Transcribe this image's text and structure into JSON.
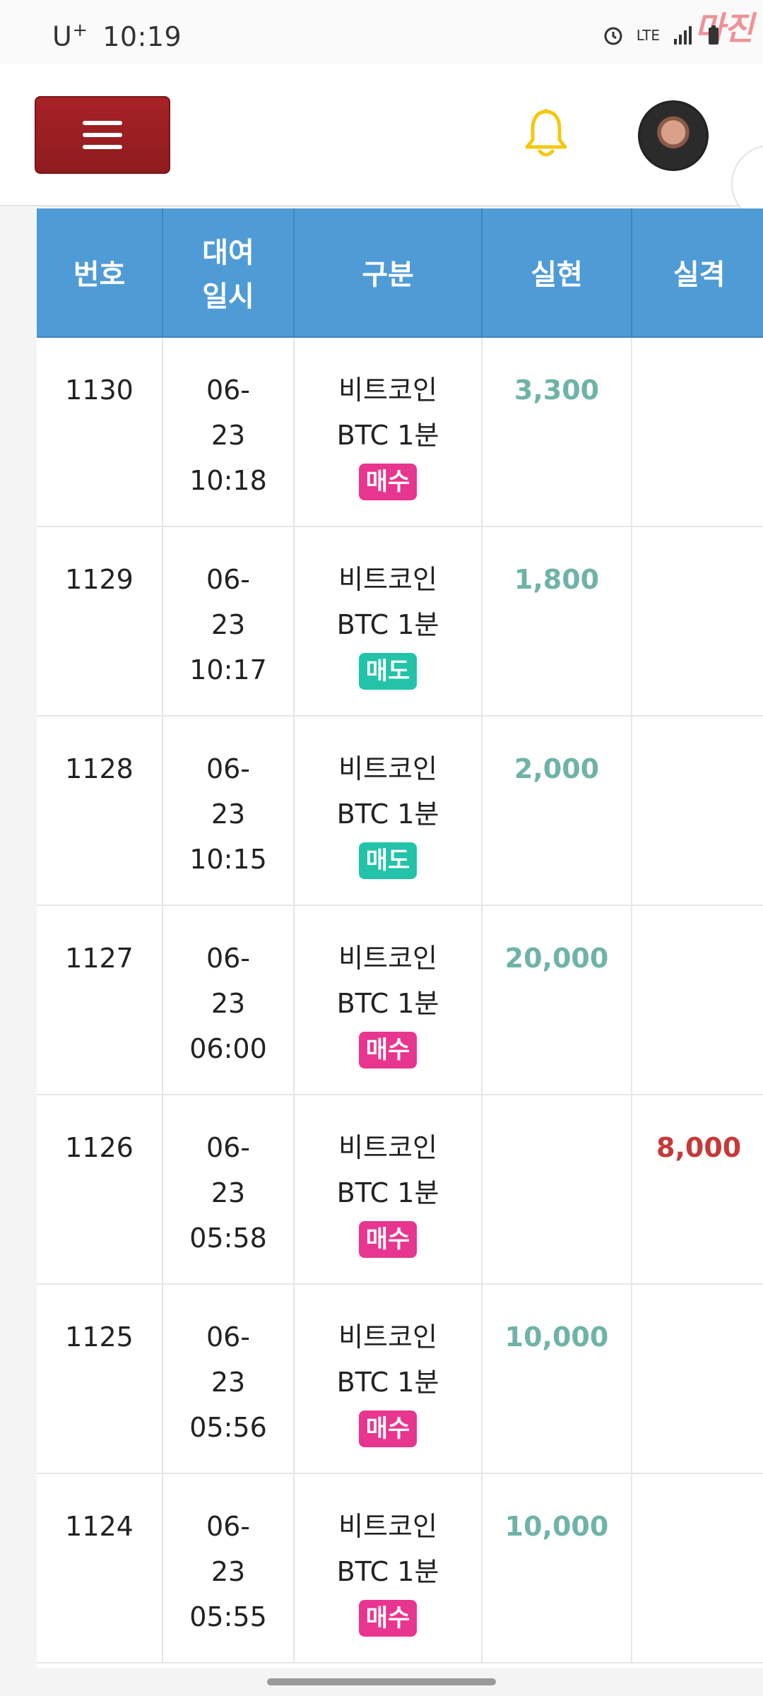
{
  "status_bar": {
    "carrier": "U",
    "carrier_sup": "+",
    "time": "10:19",
    "network": "LTE",
    "watermark": "마진"
  },
  "header": {
    "menu_icon": "hamburger-icon",
    "notification_icon": "bell-icon",
    "avatar": "user-avatar"
  },
  "table": {
    "headers": {
      "number": "번호",
      "date_line1": "대여",
      "date_line2": "일시",
      "category": "구분",
      "profit": "실현",
      "loss": "실격"
    },
    "rows": [
      {
        "number": "1130",
        "date1": "06-",
        "date2": "23",
        "time": "10:18",
        "asset": "비트코인",
        "product": "BTC 1분",
        "side": "매수",
        "side_type": "buy",
        "profit": "3,300",
        "loss": ""
      },
      {
        "number": "1129",
        "date1": "06-",
        "date2": "23",
        "time": "10:17",
        "asset": "비트코인",
        "product": "BTC 1분",
        "side": "매도",
        "side_type": "sell",
        "profit": "1,800",
        "loss": ""
      },
      {
        "number": "1128",
        "date1": "06-",
        "date2": "23",
        "time": "10:15",
        "asset": "비트코인",
        "product": "BTC 1분",
        "side": "매도",
        "side_type": "sell",
        "profit": "2,000",
        "loss": ""
      },
      {
        "number": "1127",
        "date1": "06-",
        "date2": "23",
        "time": "06:00",
        "asset": "비트코인",
        "product": "BTC 1분",
        "side": "매수",
        "side_type": "buy",
        "profit": "20,000",
        "loss": ""
      },
      {
        "number": "1126",
        "date1": "06-",
        "date2": "23",
        "time": "05:58",
        "asset": "비트코인",
        "product": "BTC 1분",
        "side": "매수",
        "side_type": "buy",
        "profit": "",
        "loss": "8,000"
      },
      {
        "number": "1125",
        "date1": "06-",
        "date2": "23",
        "time": "05:56",
        "asset": "비트코인",
        "product": "BTC 1분",
        "side": "매수",
        "side_type": "buy",
        "profit": "10,000",
        "loss": ""
      },
      {
        "number": "1124",
        "date1": "06-",
        "date2": "23",
        "time": "05:55",
        "asset": "비트코인",
        "product": "BTC 1분",
        "side": "매수",
        "side_type": "buy",
        "profit": "10,000",
        "loss": ""
      }
    ]
  },
  "colors": {
    "header_bg": "#4f9bd6",
    "menu_button": "#a72226",
    "profit": "#6fb3a8",
    "loss": "#c43a3a",
    "buy_badge": "#e8358f",
    "sell_badge": "#22c3a8",
    "bell": "#f2c811"
  }
}
